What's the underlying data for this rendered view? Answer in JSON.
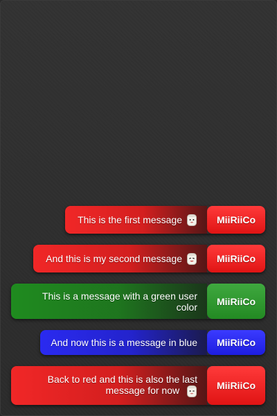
{
  "chat": {
    "messages": [
      {
        "text": "This is the first message",
        "user": "MiiRiiCo",
        "color": "red",
        "icon": "marshmallow-emoji-icon"
      },
      {
        "text": "And this is my second message",
        "user": "MiiRiiCo",
        "color": "red",
        "icon": "marshmallow-emoji-icon"
      },
      {
        "text": "This is a message with a green user color",
        "user": "MiiRiiCo",
        "color": "green",
        "icon": ""
      },
      {
        "text": "And now this is a message in blue",
        "user": "MiiRiiCo",
        "color": "blue",
        "icon": ""
      },
      {
        "text": "Back to red and this is also the last message for now",
        "user": "MiiRiiCo",
        "color": "red",
        "icon": "marshmallow-emoji-icon"
      }
    ]
  },
  "theme": {
    "background": "#2d2d2d",
    "red": "#f12727",
    "green": "#228b22",
    "blue": "#2a2af0",
    "text": "#ffffff"
  }
}
